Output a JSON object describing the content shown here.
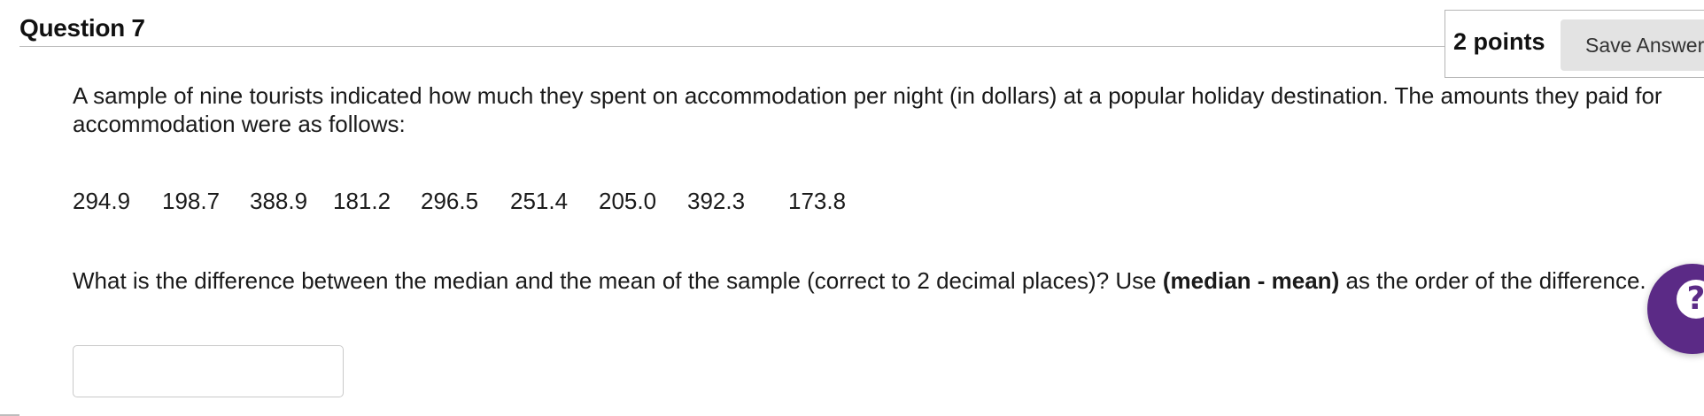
{
  "question": {
    "title": "Question 7",
    "points": "2 points",
    "save_button_label": "Save Answer",
    "prompt": "A sample of nine tourists indicated how much they spent on accommodation per night (in dollars) at a popular holiday destination. The amounts they paid for accommodation were as follows:",
    "values": [
      "294.9",
      "198.7",
      "388.9",
      "181.2",
      "296.5",
      "251.4",
      "205.0",
      "392.3",
      "173.8"
    ],
    "question_part1": "What is the difference between the median and the mean of the sample (correct to 2 decimal places)? Use ",
    "question_bold": "(median - mean)",
    "question_part2": " as the order of the difference.",
    "answer_value": ""
  },
  "help": {
    "icon": "question-mark-icon",
    "glyph": "?",
    "color": "#5b2a86"
  }
}
